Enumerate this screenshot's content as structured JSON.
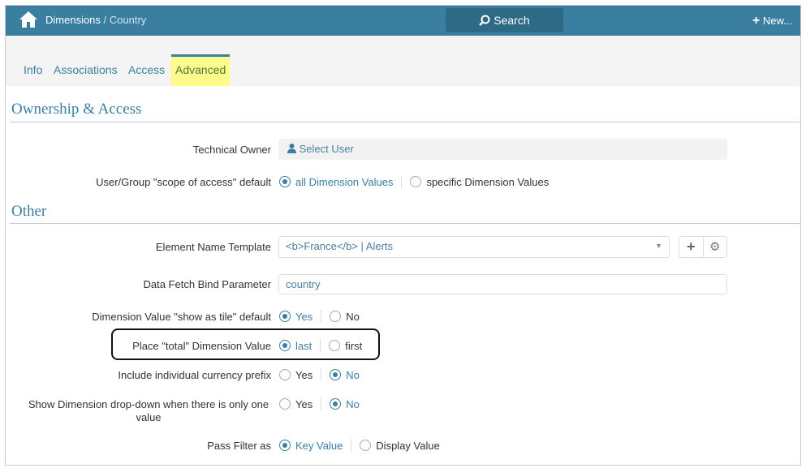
{
  "header": {
    "breadcrumb_parent": "Dimensions",
    "breadcrumb_sep": " / ",
    "breadcrumb_current": "Country",
    "search_label": "Search",
    "new_label": "New..."
  },
  "tabs": [
    {
      "label": "Info"
    },
    {
      "label": "Associations"
    },
    {
      "label": "Access"
    },
    {
      "label": "Advanced",
      "active": true
    }
  ],
  "sections": {
    "ownership": "Ownership & Access",
    "other": "Other"
  },
  "fields": {
    "technical_owner": {
      "label": "Technical Owner",
      "value": "Select User"
    },
    "scope": {
      "label": "User/Group \"scope of access\" default",
      "options": [
        "all Dimension Values",
        "specific Dimension Values"
      ],
      "selected": 0
    },
    "element_name": {
      "label": "Element Name Template",
      "value": "<b>France</b> | Alerts"
    },
    "bind_param": {
      "label": "Data Fetch Bind Parameter",
      "value": "country"
    },
    "show_tile": {
      "label": "Dimension Value \"show as tile\" default",
      "options": [
        "Yes",
        "No"
      ],
      "selected": 0
    },
    "total_place": {
      "label": "Place \"total\" Dimension Value",
      "options": [
        "last",
        "first"
      ],
      "selected": 0
    },
    "currency": {
      "label": "Include individual currency prefix",
      "options": [
        "Yes",
        "No"
      ],
      "selected": 1
    },
    "dropdown": {
      "label": "Show Dimension drop-down when there is only one value",
      "options": [
        "Yes",
        "No"
      ],
      "selected": 1
    },
    "pass_filter": {
      "label": "Pass Filter as",
      "options": [
        "Key Value",
        "Display Value"
      ],
      "selected": 0
    }
  }
}
